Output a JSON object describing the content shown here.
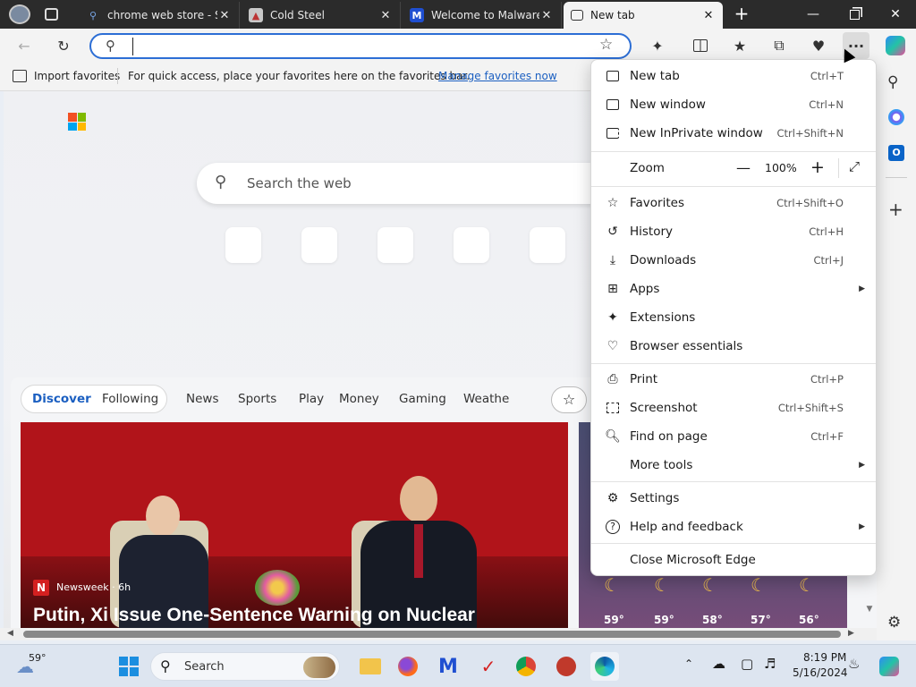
{
  "tabs": [
    {
      "title": "chrome web store - S",
      "icon": "search-icon",
      "active": false
    },
    {
      "title": "Cold Steel",
      "icon": "site-icon",
      "active": false
    },
    {
      "title": "Welcome to Malwareb",
      "icon": "malwarebytes-icon",
      "active": false
    },
    {
      "title": "New tab",
      "icon": "newtab-icon",
      "active": true
    }
  ],
  "favorites_bar": {
    "import_label": "Import favorites",
    "hint": "For quick access, place your favorites here on the favorites bar.",
    "manage_link": "Manage favorites now"
  },
  "address_bar": {
    "value": "",
    "placeholder": ""
  },
  "newtab": {
    "search_placeholder": "Search the web",
    "feed_tabs": [
      "Discover",
      "Following"
    ],
    "feed_categories": [
      "News",
      "Sports",
      "Play",
      "Money",
      "Gaming",
      "Weathe"
    ],
    "story": {
      "source": "Newsweek · 6h",
      "headline": "Putin, Xi Issue One-Sentence Warning on Nuclear"
    },
    "weather_forecast": [
      "59°",
      "59°",
      "58°",
      "57°",
      "56°"
    ]
  },
  "menu": {
    "items": [
      {
        "label": "New tab",
        "shortcut": "Ctrl+T",
        "icon": "new-tab-icon"
      },
      {
        "label": "New window",
        "shortcut": "Ctrl+N",
        "icon": "new-window-icon"
      },
      {
        "label": "New InPrivate window",
        "shortcut": "Ctrl+Shift+N",
        "icon": "inprivate-icon"
      },
      {
        "label": "Zoom",
        "zoom_value": "100%"
      },
      {
        "label": "Favorites",
        "shortcut": "Ctrl+Shift+O",
        "icon": "favorites-icon"
      },
      {
        "label": "History",
        "shortcut": "Ctrl+H",
        "icon": "history-icon"
      },
      {
        "label": "Downloads",
        "shortcut": "Ctrl+J",
        "icon": "download-icon"
      },
      {
        "label": "Apps",
        "submenu": true,
        "icon": "apps-icon"
      },
      {
        "label": "Extensions",
        "icon": "extensions-icon"
      },
      {
        "label": "Browser essentials",
        "icon": "heart-pulse-icon"
      },
      {
        "label": "Print",
        "shortcut": "Ctrl+P",
        "icon": "print-icon"
      },
      {
        "label": "Screenshot",
        "shortcut": "Ctrl+Shift+S",
        "icon": "screenshot-icon"
      },
      {
        "label": "Find on page",
        "shortcut": "Ctrl+F",
        "icon": "find-icon"
      },
      {
        "label": "More tools",
        "submenu": true
      },
      {
        "label": "Settings",
        "icon": "settings-icon"
      },
      {
        "label": "Help and feedback",
        "submenu": true,
        "icon": "help-icon"
      },
      {
        "label": "Close Microsoft Edge"
      }
    ]
  },
  "taskbar": {
    "weather_temp": "59°",
    "search_label": "Search",
    "time": "8:19 PM",
    "date": "5/16/2024"
  },
  "colors": {
    "accent": "#2c6ed5",
    "titlebar": "#2b2b2b",
    "story_bg": "#b1141a"
  }
}
